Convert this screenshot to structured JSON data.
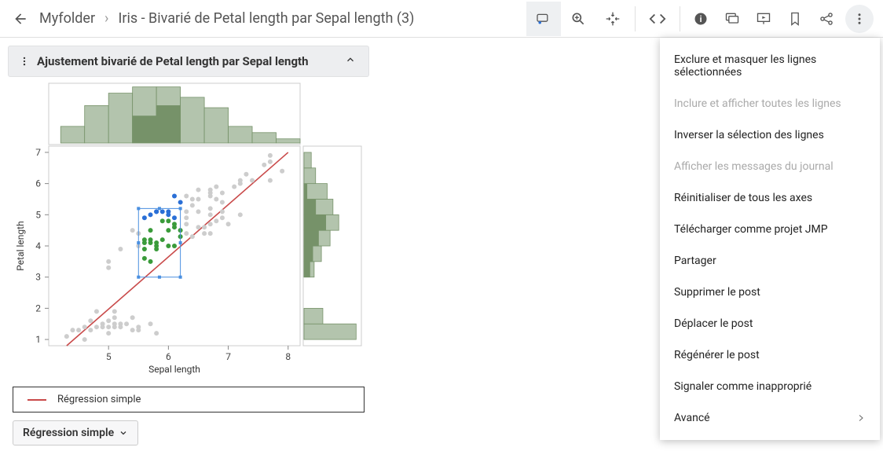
{
  "header": {
    "breadcrumb": [
      "Myfolder",
      "Iris - Bivarié de Petal length par Sepal length (3)"
    ]
  },
  "panel": {
    "title": "Ajustement bivarié de Petal length par Sepal length"
  },
  "legend": {
    "label": "Régression simple"
  },
  "dropdown": {
    "label": "Régression simple"
  },
  "menu": {
    "items": [
      {
        "label": "Exclure et masquer les lignes sélectionnées",
        "enabled": true
      },
      {
        "label": "Inclure et afficher toutes les lignes",
        "enabled": false
      },
      {
        "label": "Inverser la sélection des lignes",
        "enabled": true
      },
      {
        "label": "Afficher les messages du journal",
        "enabled": false
      },
      {
        "label": "Réinitialiser de tous les axes",
        "enabled": true
      },
      {
        "label": "Télécharger comme projet JMP",
        "enabled": true
      },
      {
        "label": "Partager",
        "enabled": true
      },
      {
        "label": "Supprimer le post",
        "enabled": true
      },
      {
        "label": "Déplacer le post",
        "enabled": true
      },
      {
        "label": "Régénérer le post",
        "enabled": true
      },
      {
        "label": "Signaler comme inapproprié",
        "enabled": true
      },
      {
        "label": "Avancé",
        "enabled": true,
        "submenu": true
      }
    ]
  },
  "chart_data": {
    "type": "scatter",
    "title": "",
    "xlabel": "Sepal length",
    "ylabel": "Petal length",
    "xlim": [
      4,
      8.2
    ],
    "ylim": [
      0.8,
      7.2
    ],
    "xticks": [
      5,
      6,
      7,
      8
    ],
    "yticks": [
      1,
      2,
      3,
      4,
      5,
      6,
      7
    ],
    "regression": {
      "x0": 4.3,
      "y0": 0.8,
      "x1": 8.0,
      "y1": 7.0
    },
    "selection_rect": {
      "x0": 5.5,
      "y0": 3.0,
      "x1": 6.2,
      "y1": 5.2
    },
    "points_unselected": [
      [
        4.3,
        1.1
      ],
      [
        4.4,
        1.3
      ],
      [
        4.5,
        1.3
      ],
      [
        4.6,
        1.0
      ],
      [
        4.6,
        1.4
      ],
      [
        4.7,
        1.3
      ],
      [
        4.7,
        1.6
      ],
      [
        4.8,
        1.4
      ],
      [
        4.8,
        1.9
      ],
      [
        4.9,
        1.4
      ],
      [
        4.9,
        1.5
      ],
      [
        5.0,
        1.2
      ],
      [
        5.0,
        1.4
      ],
      [
        5.0,
        1.6
      ],
      [
        5.1,
        1.4
      ],
      [
        5.1,
        1.5
      ],
      [
        5.1,
        1.7
      ],
      [
        5.1,
        1.9
      ],
      [
        5.2,
        1.4
      ],
      [
        5.2,
        1.5
      ],
      [
        5.3,
        1.5
      ],
      [
        5.4,
        1.3
      ],
      [
        5.4,
        1.7
      ],
      [
        5.5,
        1.3
      ],
      [
        5.5,
        1.4
      ],
      [
        5.7,
        1.5
      ],
      [
        5.8,
        1.2
      ],
      [
        5.0,
        3.3
      ],
      [
        5.0,
        3.5
      ],
      [
        5.2,
        3.9
      ],
      [
        5.4,
        4.5
      ],
      [
        5.5,
        4.0
      ],
      [
        5.5,
        4.4
      ],
      [
        6.3,
        4.4
      ],
      [
        6.3,
        4.7
      ],
      [
        6.3,
        4.9
      ],
      [
        6.3,
        5.1
      ],
      [
        6.3,
        5.6
      ],
      [
        6.4,
        4.3
      ],
      [
        6.4,
        5.3
      ],
      [
        6.4,
        5.5
      ],
      [
        6.5,
        4.6
      ],
      [
        6.5,
        5.1
      ],
      [
        6.5,
        5.5
      ],
      [
        6.5,
        5.8
      ],
      [
        6.6,
        4.4
      ],
      [
        6.6,
        4.6
      ],
      [
        6.7,
        4.4
      ],
      [
        6.7,
        4.7
      ],
      [
        6.7,
        5.0
      ],
      [
        6.7,
        5.2
      ],
      [
        6.7,
        5.6
      ],
      [
        6.7,
        5.7
      ],
      [
        6.7,
        5.8
      ],
      [
        6.8,
        4.8
      ],
      [
        6.8,
        5.5
      ],
      [
        6.8,
        5.9
      ],
      [
        6.9,
        4.9
      ],
      [
        6.9,
        5.1
      ],
      [
        6.9,
        5.4
      ],
      [
        6.9,
        5.7
      ],
      [
        7.0,
        4.7
      ],
      [
        7.1,
        5.9
      ],
      [
        7.2,
        5.0
      ],
      [
        7.2,
        6.0
      ],
      [
        7.2,
        6.1
      ],
      [
        7.3,
        6.3
      ],
      [
        7.4,
        6.1
      ],
      [
        7.6,
        6.6
      ],
      [
        7.7,
        6.1
      ],
      [
        7.7,
        6.7
      ],
      [
        7.7,
        6.9
      ],
      [
        7.9,
        6.4
      ]
    ],
    "points_green": [
      [
        5.6,
        3.6
      ],
      [
        5.6,
        3.9
      ],
      [
        5.6,
        4.1
      ],
      [
        5.6,
        4.2
      ],
      [
        5.7,
        3.5
      ],
      [
        5.7,
        4.1
      ],
      [
        5.7,
        4.2
      ],
      [
        5.7,
        4.5
      ],
      [
        5.8,
        3.9
      ],
      [
        5.8,
        4.0
      ],
      [
        5.8,
        4.1
      ],
      [
        5.9,
        4.2
      ],
      [
        5.9,
        4.8
      ],
      [
        6.0,
        4.0
      ],
      [
        6.0,
        4.5
      ],
      [
        6.0,
        4.8
      ],
      [
        6.1,
        4.0
      ],
      [
        6.1,
        4.6
      ],
      [
        6.1,
        4.7
      ],
      [
        6.2,
        4.3
      ],
      [
        6.2,
        4.5
      ]
    ],
    "points_blue": [
      [
        5.6,
        4.9
      ],
      [
        5.7,
        5.0
      ],
      [
        5.8,
        5.1
      ],
      [
        5.8,
        5.1
      ],
      [
        5.9,
        5.1
      ],
      [
        6.0,
        5.0
      ],
      [
        6.0,
        5.1
      ],
      [
        6.1,
        4.9
      ],
      [
        6.1,
        5.6
      ],
      [
        6.2,
        5.4
      ]
    ],
    "top_hist": {
      "bins": [
        {
          "x": 4.2,
          "w": 0.4,
          "h": 8,
          "sel": 0
        },
        {
          "x": 4.6,
          "w": 0.4,
          "h": 18,
          "sel": 0
        },
        {
          "x": 5.0,
          "w": 0.4,
          "h": 24,
          "sel": 0
        },
        {
          "x": 5.4,
          "w": 0.4,
          "h": 27,
          "sel": 13
        },
        {
          "x": 5.8,
          "w": 0.4,
          "h": 27,
          "sel": 18
        },
        {
          "x": 6.2,
          "w": 0.4,
          "h": 22,
          "sel": 0
        },
        {
          "x": 6.6,
          "w": 0.4,
          "h": 17,
          "sel": 0
        },
        {
          "x": 7.0,
          "w": 0.4,
          "h": 8,
          "sel": 0
        },
        {
          "x": 7.4,
          "w": 0.4,
          "h": 5,
          "sel": 0
        },
        {
          "x": 7.8,
          "w": 0.4,
          "h": 2,
          "sel": 0
        }
      ],
      "max": 28
    },
    "right_hist": {
      "bins": [
        {
          "y": 1.0,
          "h": 0.5,
          "w": 36,
          "sel": 0
        },
        {
          "y": 1.5,
          "h": 0.5,
          "w": 13,
          "sel": 0
        },
        {
          "y": 2.0,
          "h": 0.5,
          "w": 0,
          "sel": 0
        },
        {
          "y": 3.0,
          "h": 0.5,
          "w": 7,
          "sel": 4
        },
        {
          "y": 3.5,
          "h": 0.5,
          "w": 12,
          "sel": 6
        },
        {
          "y": 4.0,
          "h": 0.5,
          "w": 18,
          "sel": 10
        },
        {
          "y": 4.5,
          "h": 0.5,
          "w": 24,
          "sel": 15
        },
        {
          "y": 5.0,
          "h": 0.5,
          "w": 20,
          "sel": 8
        },
        {
          "y": 5.5,
          "h": 0.5,
          "w": 16,
          "sel": 2
        },
        {
          "y": 6.0,
          "h": 0.5,
          "w": 8,
          "sel": 0
        },
        {
          "y": 6.5,
          "h": 0.5,
          "w": 5,
          "sel": 0
        }
      ],
      "max": 38
    }
  }
}
